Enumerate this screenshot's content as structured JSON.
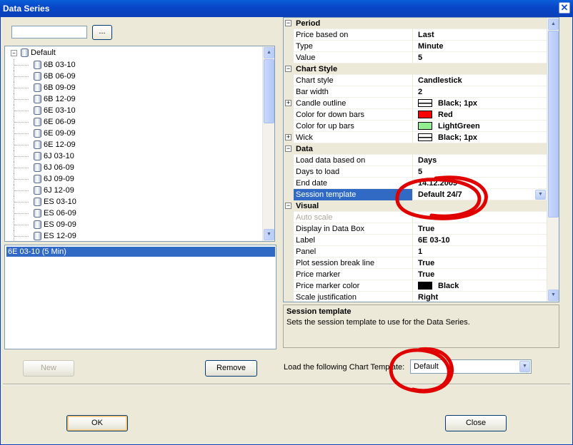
{
  "window": {
    "title": "Data Series",
    "close_glyph": "✕"
  },
  "search": {
    "value": "",
    "browse_label": "..."
  },
  "tree": {
    "root_label": "Default",
    "items": [
      "6B 03-10",
      "6B 06-09",
      "6B 09-09",
      "6B 12-09",
      "6E 03-10",
      "6E 06-09",
      "6E 09-09",
      "6E 12-09",
      "6J 03-10",
      "6J 06-09",
      "6J 09-09",
      "6J 12-09",
      "ES 03-10",
      "ES 06-09",
      "ES 09-09",
      "ES 12-09"
    ]
  },
  "selected_series": {
    "label": "6E 03-10 (5 Min)"
  },
  "buttons": {
    "new": "New",
    "remove": "Remove",
    "ok": "OK",
    "close": "Close"
  },
  "properties": {
    "period_header": "Period",
    "price_based_on": {
      "name": "Price based on",
      "value": "Last"
    },
    "type": {
      "name": "Type",
      "value": "Minute"
    },
    "value": {
      "name": "Value",
      "value": "5"
    },
    "chart_style_header": "Chart Style",
    "chart_style": {
      "name": "Chart style",
      "value": "Candlestick"
    },
    "bar_width": {
      "name": "Bar width",
      "value": "2"
    },
    "candle_outline": {
      "name": "Candle outline",
      "value": "Black; 1px"
    },
    "color_down": {
      "name": "Color for down bars",
      "value": "Red",
      "color": "#ff0000"
    },
    "color_up": {
      "name": "Color for up bars",
      "value": "LightGreen",
      "color": "#90ee90"
    },
    "wick": {
      "name": "Wick",
      "value": "Black; 1px"
    },
    "data_header": "Data",
    "load_based_on": {
      "name": "Load data based on",
      "value": "Days"
    },
    "days_to_load": {
      "name": "Days to load",
      "value": "5"
    },
    "end_date": {
      "name": "End date",
      "value": "14.12.2009"
    },
    "session_template": {
      "name": "Session template",
      "value": "Default 24/7"
    },
    "visual_header": "Visual",
    "auto_scale": {
      "name": "Auto scale",
      "value": ""
    },
    "display_data_box": {
      "name": "Display in Data Box",
      "value": "True"
    },
    "label": {
      "name": "Label",
      "value": "6E 03-10"
    },
    "panel": {
      "name": "Panel",
      "value": "1"
    },
    "plot_session_break": {
      "name": "Plot session break line",
      "value": "True"
    },
    "price_marker": {
      "name": "Price marker",
      "value": "True"
    },
    "price_marker_color": {
      "name": "Price marker color",
      "value": "Black",
      "color": "#000000"
    },
    "scale_justification": {
      "name": "Scale justification",
      "value": "Right"
    }
  },
  "description": {
    "title": "Session template",
    "text": "Sets the session template to use for the Data Series."
  },
  "chart_template": {
    "label": "Load the following Chart Template:",
    "value": "Default"
  },
  "colors": {
    "title_bar": "#0a4fd0",
    "selection": "#316ac5",
    "annotation": "#e00000"
  }
}
